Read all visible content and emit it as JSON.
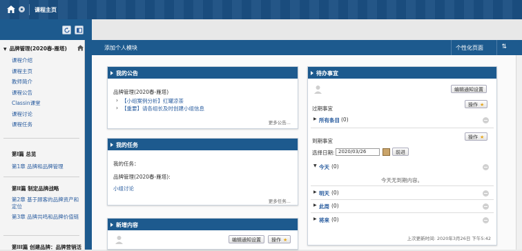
{
  "topbar": {
    "title": "课程主页"
  },
  "sidebar": {
    "heading": "品牌管理(2020春-雁塔)",
    "items": [
      "课程介绍",
      "课程主页",
      "教师简介",
      "课程公告",
      "Classin课堂",
      "课程讨论",
      "课程任务"
    ],
    "sections": [
      {
        "title": "第I篇 总览",
        "links": [
          "第1章 品牌和品牌管理"
        ]
      },
      {
        "title": "第II篇 制定品牌战略",
        "links": [
          "第2章 基于顾客的品牌资产和定位",
          "第3章 品牌共鸣和品牌价值链"
        ]
      },
      {
        "title": "第III篇 创建品牌：品牌营销活"
      }
    ]
  },
  "toolbar": {
    "add_module": "添加个人模块",
    "personalize": "个性化页面",
    "sort_icon": "⇅"
  },
  "announcements": {
    "title": "我的公告",
    "course": "品牌管理(2020春-雁塔)",
    "items": [
      "【小组案例分析】红罐凉茶",
      "【重要】请各组长及时创建小组信息"
    ],
    "more": "更多公告..."
  },
  "tasks": {
    "title": "我的任务",
    "label": "我的任务：",
    "course": "品牌管理(2020春-雁塔):",
    "link": "小组讨论",
    "more": "更多任务..."
  },
  "new_content": {
    "title": "新增内容",
    "edit_btn": "编辑通知设置",
    "op_btn": "操作"
  },
  "todo": {
    "title": "待办事宜",
    "edit_btn": "编辑通知设置",
    "op_btn": "操作",
    "overdue_title": "过期事宜",
    "all_items": "所有条目",
    "all_count": "(0)",
    "upcoming_title": "到期事宜",
    "select_date_label": "选择日期:",
    "date_value": "2020/03/26",
    "go_btn": "前进",
    "today": "今天",
    "today_count": "(0)",
    "no_due_msg": "今天无到期内容。",
    "tomorrow": "明天",
    "tomorrow_count": "(0)",
    "this_week": "此周",
    "this_week_count": "(0)",
    "future": "将来",
    "future_count": "(0)",
    "last_updated": "上次更新时间: 2020年3月26日 下午5:42"
  },
  "colors": {
    "header_blue": "#1d5a8e",
    "link_blue": "#2a5d9f",
    "star": "#e6a51a"
  }
}
